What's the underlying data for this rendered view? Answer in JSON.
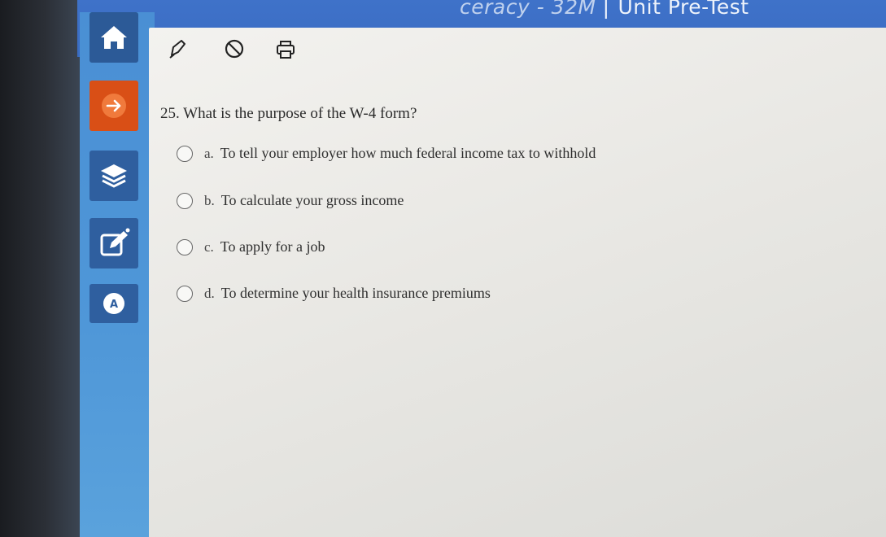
{
  "header": {
    "breadcrumb": "ceracy - 32M",
    "separator": "|",
    "title": "Unit Pre-Test"
  },
  "sidebar": {
    "items": [
      {
        "name": "home",
        "icon": "home-icon"
      },
      {
        "name": "next",
        "icon": "arrow-right-icon",
        "active_color": "#e8611a"
      },
      {
        "name": "layers",
        "icon": "layers-icon"
      },
      {
        "name": "edit",
        "icon": "edit-icon"
      },
      {
        "name": "accessibility",
        "icon": "text-to-speech-icon"
      }
    ]
  },
  "toolbar": {
    "icons": [
      "pen-icon",
      "eliminate-icon",
      "print-icon"
    ]
  },
  "question": {
    "number": "25.",
    "text": "What is the purpose of the W-4 form?",
    "options": [
      {
        "letter": "a.",
        "text": "To tell your employer how much federal income tax to withhold"
      },
      {
        "letter": "b.",
        "text": "To calculate your gross income"
      },
      {
        "letter": "c.",
        "text": "To apply for a job"
      },
      {
        "letter": "d.",
        "text": "To determine your health insurance premiums"
      }
    ]
  },
  "colors": {
    "header_blue": "#3f72c9",
    "sidebar_blue": "#4f97d8",
    "button_dark_blue": "#2f5f9f",
    "active_orange": "#e8611a",
    "content_bg": "#ecebe8"
  }
}
